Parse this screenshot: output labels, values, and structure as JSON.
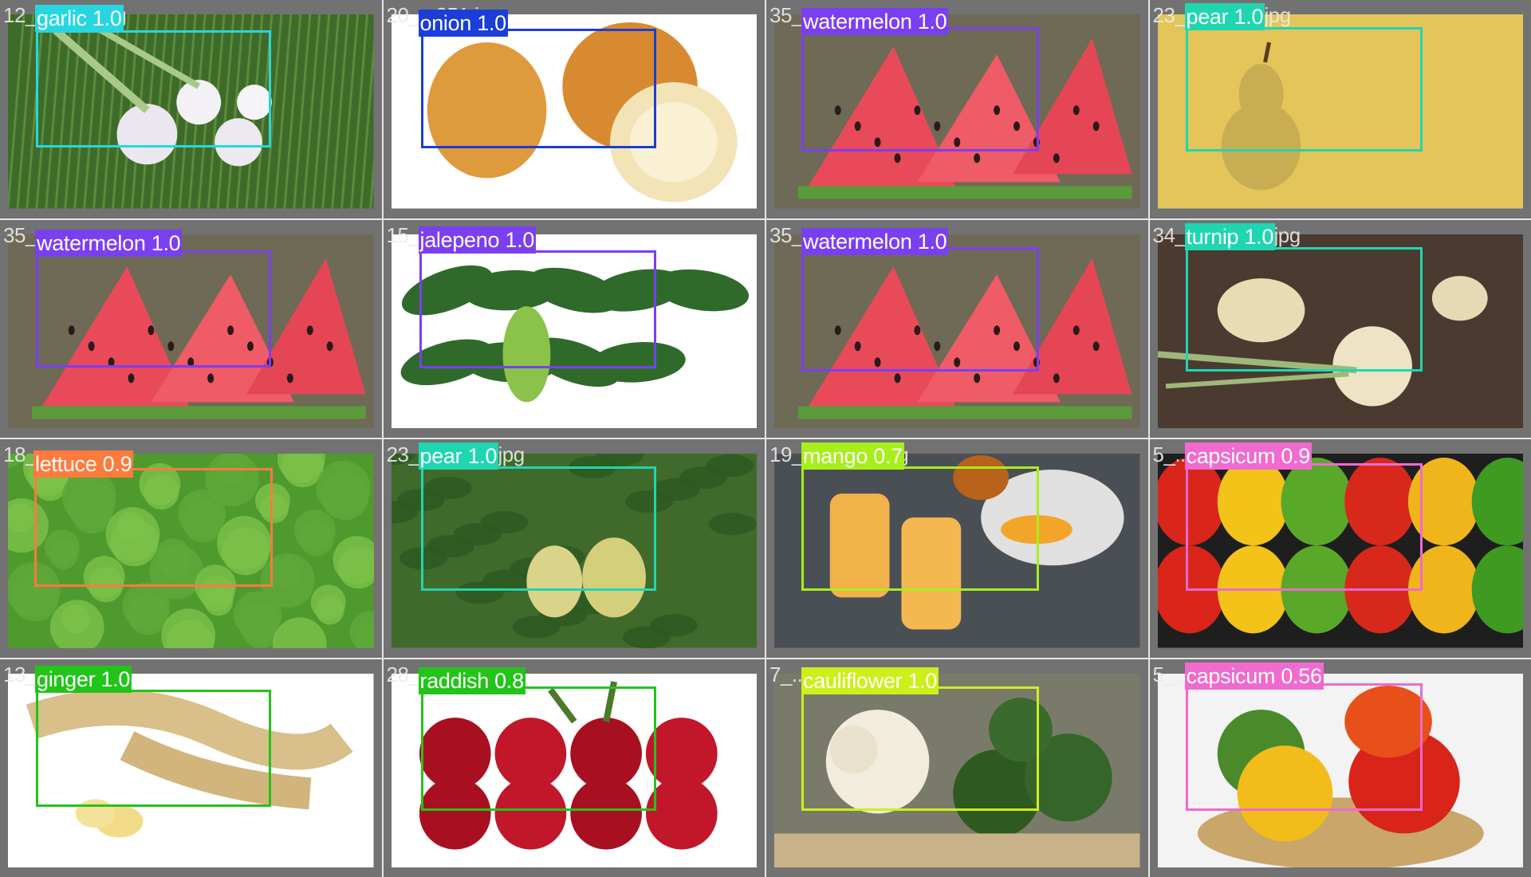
{
  "tiles": [
    {
      "filename": "12_garlic...jpg",
      "label": "garlic 1.0",
      "color": "#26d7e0",
      "subject": "garlic"
    },
    {
      "filename": "20_...351.jpg",
      "label": "onion 1.0",
      "color": "#1a3ed6",
      "subject": "onion"
    },
    {
      "filename": "35_...",
      "label": "watermelon 1.0",
      "color": "#7b3ff2",
      "subject": "watermelon"
    },
    {
      "filename": "23_pear 1.0.jpg",
      "label": "pear 1.0",
      "color": "#1fd6b0",
      "subject": "pear"
    },
    {
      "filename": "35_...",
      "label": "watermelon 1.0",
      "color": "#7b3ff2",
      "subject": "watermelon"
    },
    {
      "filename": "15_...",
      "label": "jalepeno 1.0",
      "color": "#7b3ff2",
      "subject": "jalapeno"
    },
    {
      "filename": "35_...",
      "label": "watermelon 1.0",
      "color": "#7b3ff2",
      "subject": "watermelon"
    },
    {
      "filename": "34_turnip 1.0.jpg",
      "label": "turnip 1.0",
      "color": "#1fd6b0",
      "subject": "turnip"
    },
    {
      "filename": "18_...",
      "label": "lettuce 0.9",
      "color": "#ff7a3d",
      "subject": "lettuce"
    },
    {
      "filename": "23_pear 1.0.jpg",
      "label": "pear 1.0",
      "color": "#1fd6b0",
      "subject": "pear-tree"
    },
    {
      "filename": "19_mango 0.7g",
      "label": "mango 0.7",
      "color": "#a6ef1a",
      "subject": "mango"
    },
    {
      "filename": "5_...",
      "label": "capsicum 0.9",
      "color": "#f06ad0",
      "subject": "capsicum"
    },
    {
      "filename": "13_...",
      "label": "ginger 1.0",
      "color": "#23c41a",
      "subject": "ginger"
    },
    {
      "filename": "28_...",
      "label": "raddish 0.8",
      "color": "#23c41a",
      "subject": "radish"
    },
    {
      "filename": "7_...",
      "label": "cauliflower 1.0",
      "color": "#cdef1a",
      "subject": "cauliflower"
    },
    {
      "filename": "5_...",
      "label": "capsicum 0.56",
      "color": "#f06ad0",
      "subject": "capsicum-basket"
    }
  ]
}
